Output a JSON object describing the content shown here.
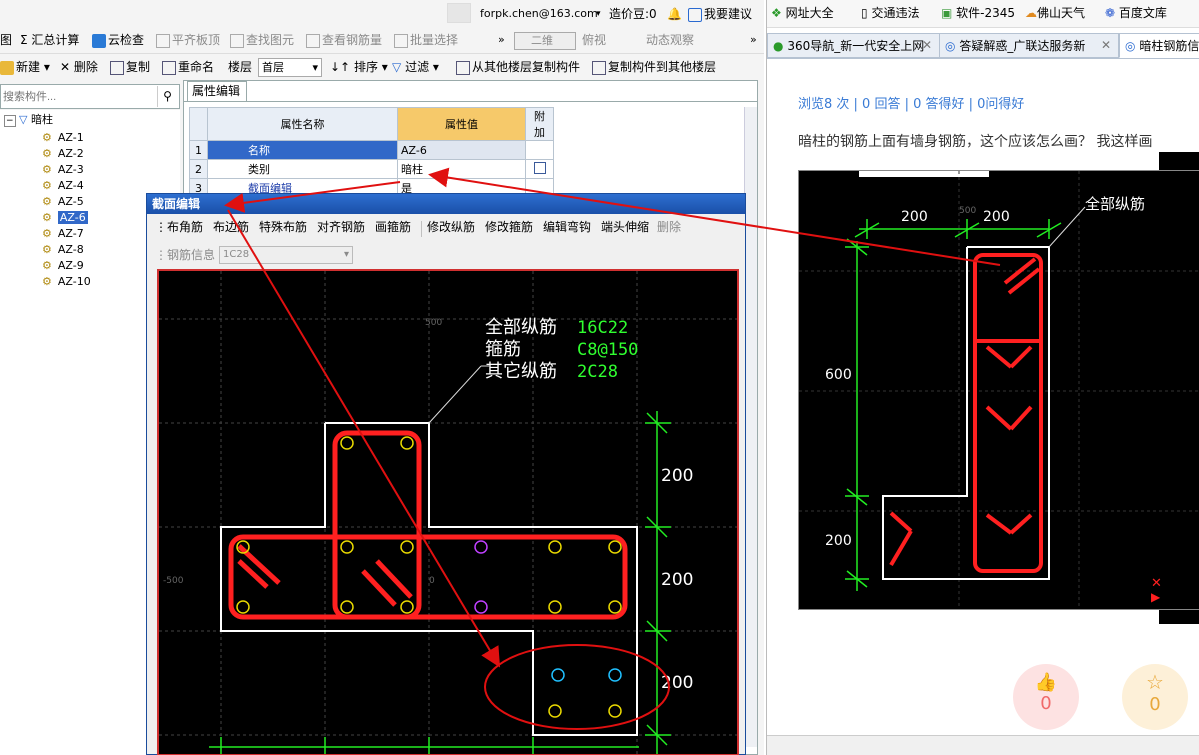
{
  "topbar": {
    "email": "forpk.chen@163.com",
    "price_label": "造价豆:0",
    "suggest": "我要建议"
  },
  "toolbar1": {
    "items": [
      "图",
      "Σ 汇总计算",
      "云检查",
      "平齐板顶",
      "查找图元",
      "查看钢筋量",
      "批量选择"
    ],
    "view_mode": "二维",
    "view_items": [
      "俯视",
      "动态观察"
    ]
  },
  "toolbar2": {
    "new": "新建",
    "delete": "删除",
    "copy": "复制",
    "rename": "重命名",
    "floor_label": "楼层",
    "floor_value": "首层",
    "sort": "排序",
    "filter": "过滤",
    "copy_from": "从其他楼层复制构件",
    "copy_to": "复制构件到其他楼层"
  },
  "search": {
    "placeholder": "搜索构件..."
  },
  "tree": {
    "root": "暗柱",
    "items": [
      "AZ-1",
      "AZ-2",
      "AZ-3",
      "AZ-4",
      "AZ-5",
      "AZ-6",
      "AZ-7",
      "AZ-8",
      "AZ-9",
      "AZ-10"
    ],
    "selected": "AZ-6"
  },
  "props": {
    "tab": "属性编辑",
    "headers": [
      "属性名称",
      "属性值",
      "附加"
    ],
    "rows": [
      {
        "n": "1",
        "name": "名称",
        "value": "AZ-6"
      },
      {
        "n": "2",
        "name": "类别",
        "value": "暗柱"
      },
      {
        "n": "3",
        "name": "截面编辑",
        "value": "是"
      }
    ]
  },
  "dialog": {
    "title": "截面编辑",
    "tools": [
      "布角筋",
      "布边筋",
      "特殊布筋",
      "对齐钢筋",
      "画箍筋",
      "修改纵筋",
      "修改箍筋",
      "编辑弯钩",
      "端头伸缩",
      "删除"
    ],
    "rebar_info_label": "钢筋信息",
    "rebar_info_value": "1C28"
  },
  "canvas": {
    "label_all": "全部纵筋",
    "label_stirrup": "箍筋",
    "label_other": "其它纵筋",
    "val_all": "16C22",
    "val_stirrup": "C8@150",
    "val_other": "2C28",
    "dims": [
      "200",
      "200",
      "200"
    ],
    "grid_label_500": "500",
    "grid_label_neg500": "-500",
    "grid_label_0": "0"
  },
  "browser": {
    "bookmarks": [
      "网址大全",
      "交通违法",
      "软件-2345",
      "佛山天气",
      "百度文库"
    ],
    "tabs": [
      "360导航_新一代安全上网",
      "答疑解惑_广联达服务新",
      "暗柱钢筋信"
    ],
    "stats": "浏览8 次 | 0 回答 | 0 答得好 | 0问得好",
    "question": "暗柱的钢筋上面有墙身钢筋，这个应该怎么画？ 我这样画",
    "img_label": "全部纵筋",
    "img_dims": [
      "200",
      "200",
      "600",
      "200"
    ],
    "like_count": "0",
    "fav_count": "0"
  },
  "colors": {
    "rebar_red": "#ff2020",
    "dim_green": "#22ee22",
    "annotation_red": "#e01010"
  }
}
